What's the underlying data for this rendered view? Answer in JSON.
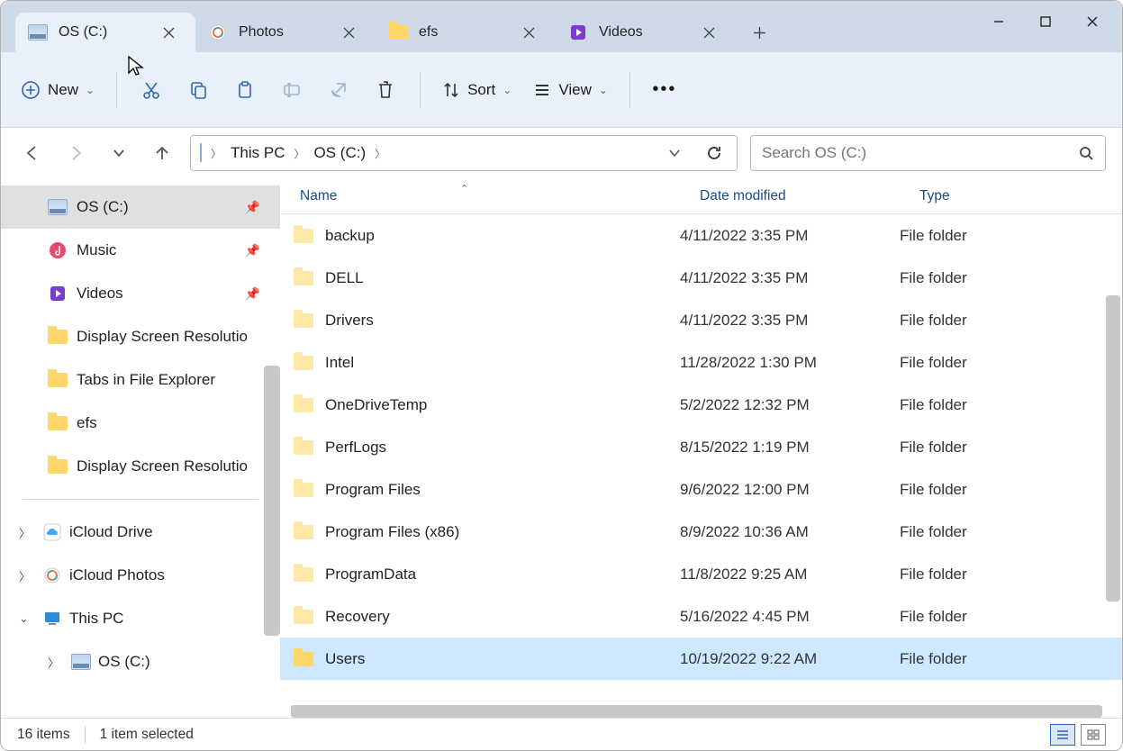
{
  "tabs": [
    {
      "title": "OS (C:)",
      "icon": "drive"
    },
    {
      "title": "Photos",
      "icon": "photos"
    },
    {
      "title": "efs",
      "icon": "folder"
    },
    {
      "title": "Videos",
      "icon": "videos"
    }
  ],
  "active_tab": 0,
  "toolbar": {
    "new": "New",
    "sort": "Sort",
    "view": "View"
  },
  "breadcrumbs": [
    "This PC",
    "OS (C:)"
  ],
  "search_placeholder": "Search OS (C:)",
  "sidebar_quick": [
    {
      "label": "OS (C:)",
      "icon": "drive",
      "pinned": true,
      "selected": true
    },
    {
      "label": "Music",
      "icon": "music",
      "pinned": true
    },
    {
      "label": "Videos",
      "icon": "videos",
      "pinned": true
    },
    {
      "label": "Display Screen Resolutio",
      "icon": "folder"
    },
    {
      "label": "Tabs in File Explorer",
      "icon": "folder"
    },
    {
      "label": "efs",
      "icon": "folder"
    },
    {
      "label": "Display Screen Resolutio",
      "icon": "folder"
    }
  ],
  "sidebar_tree": [
    {
      "label": "iCloud Drive",
      "icon": "icloud",
      "expanded": false,
      "level": 0
    },
    {
      "label": "iCloud Photos",
      "icon": "photos",
      "expanded": false,
      "level": 0
    },
    {
      "label": "This PC",
      "icon": "pc",
      "expanded": true,
      "level": 0
    },
    {
      "label": "OS (C:)",
      "icon": "drive",
      "expanded": false,
      "level": 1
    }
  ],
  "columns": {
    "name": "Name",
    "date": "Date modified",
    "type": "Type"
  },
  "rows": [
    {
      "name": "backup",
      "date": "4/11/2022 3:35 PM",
      "type": "File folder"
    },
    {
      "name": "DELL",
      "date": "4/11/2022 3:35 PM",
      "type": "File folder"
    },
    {
      "name": "Drivers",
      "date": "4/11/2022 3:35 PM",
      "type": "File folder"
    },
    {
      "name": "Intel",
      "date": "11/28/2022 1:30 PM",
      "type": "File folder"
    },
    {
      "name": "OneDriveTemp",
      "date": "5/2/2022 12:32 PM",
      "type": "File folder"
    },
    {
      "name": "PerfLogs",
      "date": "8/15/2022 1:19 PM",
      "type": "File folder"
    },
    {
      "name": "Program Files",
      "date": "9/6/2022 12:00 PM",
      "type": "File folder"
    },
    {
      "name": "Program Files (x86)",
      "date": "8/9/2022 10:36 AM",
      "type": "File folder"
    },
    {
      "name": "ProgramData",
      "date": "11/8/2022 9:25 AM",
      "type": "File folder"
    },
    {
      "name": "Recovery",
      "date": "5/16/2022 4:45 PM",
      "type": "File folder"
    },
    {
      "name": "Users",
      "date": "10/19/2022 9:22 AM",
      "type": "File folder",
      "selected": true
    }
  ],
  "status": {
    "items": "16 items",
    "selected": "1 item selected"
  }
}
